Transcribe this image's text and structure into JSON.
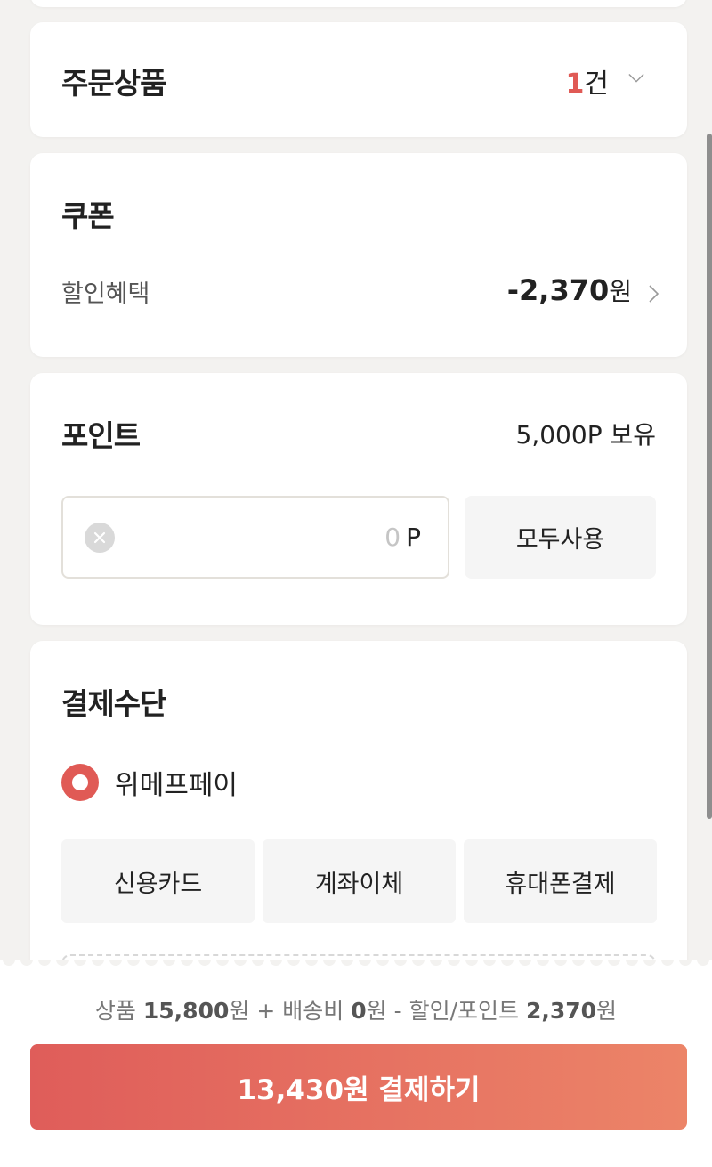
{
  "order": {
    "title": "주문상품",
    "count": "1",
    "count_unit": "건"
  },
  "coupon": {
    "title": "쿠폰",
    "label": "할인혜택",
    "amount": "-2,370",
    "unit": "원"
  },
  "point": {
    "title": "포인트",
    "owned": "5,000P 보유",
    "input_value": "0",
    "input_unit": "P",
    "use_all_label": "모두사용"
  },
  "payment": {
    "title": "결제수단",
    "selected_option": "위메프페이",
    "methods": [
      "신용카드",
      "계좌이체",
      "휴대폰결제"
    ]
  },
  "summary": {
    "product_label": "상품",
    "product_amount": "15,800",
    "shipping_label": "배송비",
    "shipping_amount": "0",
    "discount_label": "할인/포인트",
    "discount_amount": "2,370",
    "won": "원",
    "plus": "+",
    "minus": "-"
  },
  "checkout": {
    "label": "13,430원 결제하기"
  },
  "colors": {
    "accent": "#e05a55",
    "gradient_end": "#ec8468",
    "background": "#f3f2f0"
  }
}
